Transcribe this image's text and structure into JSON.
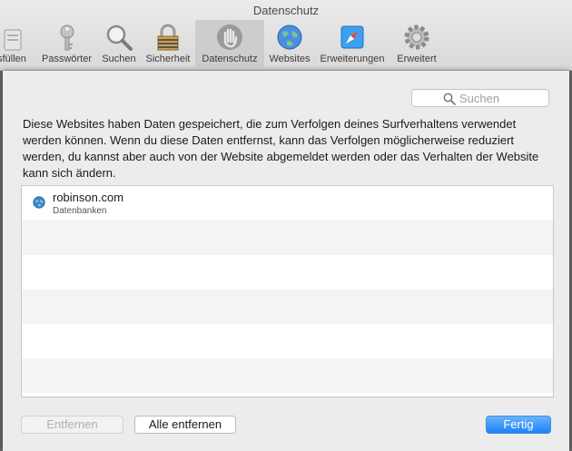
{
  "window": {
    "title": "Datenschutz"
  },
  "toolbar": {
    "items": [
      {
        "label": "sfüllen",
        "icon": "autofill-icon"
      },
      {
        "label": "Passwörter",
        "icon": "key-icon"
      },
      {
        "label": "Suchen",
        "icon": "magnifier-icon"
      },
      {
        "label": "Sicherheit",
        "icon": "lock-icon"
      },
      {
        "label": "Datenschutz",
        "icon": "hand-icon",
        "selected": true
      },
      {
        "label": "Websites",
        "icon": "globe-icon"
      },
      {
        "label": "Erweiterungen",
        "icon": "puzzle-compass-icon"
      },
      {
        "label": "Erweitert",
        "icon": "gear-icon"
      }
    ]
  },
  "search": {
    "placeholder": "Suchen"
  },
  "description": "Diese Websites haben Daten gespeichert, die zum Verfolgen deines Surfverhaltens verwendet werden können. Wenn du diese Daten entfernst, kann das Verfolgen möglicherweise reduziert werden, du kannst aber auch von der Website abgemeldet werden oder das Verhalten der Website kann sich ändern.",
  "websites": [
    {
      "name": "robinson.com",
      "detail": "Datenbanken",
      "icon": "globe-icon"
    }
  ],
  "buttons": {
    "remove": "Entfernen",
    "remove_all": "Alle entfernen",
    "done": "Fertig"
  },
  "colors": {
    "accent": "#1a82fb",
    "selected_tab": "#cdcdcd"
  }
}
